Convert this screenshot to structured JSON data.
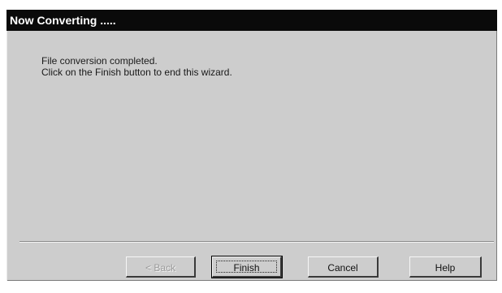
{
  "window": {
    "title": "Now Converting ....."
  },
  "message": {
    "line1": "File conversion completed.",
    "line2": "Click on the Finish button to end this wizard."
  },
  "buttons": {
    "back_label": "< Back",
    "back_enabled": false,
    "finish_label": "Finish",
    "cancel_label": "Cancel",
    "help_label": "Help"
  },
  "colors": {
    "titlebar": "#0a0a0a",
    "dialog_face": "#cdcdcd",
    "disabled_text": "#9c9c9c"
  }
}
